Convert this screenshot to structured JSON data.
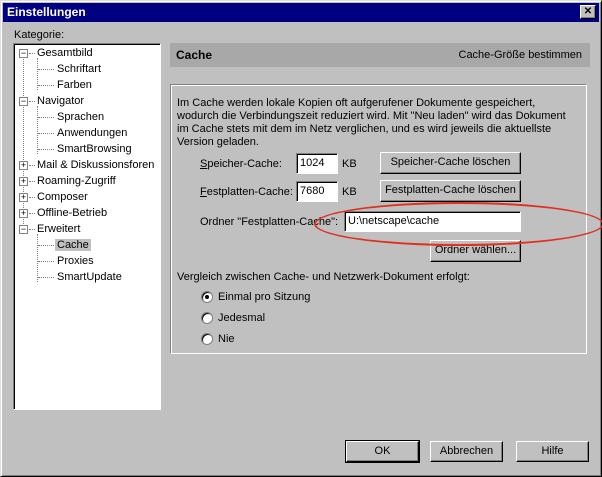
{
  "window": {
    "title": "Einstellungen",
    "close_icon": "close-icon"
  },
  "sidebar": {
    "label": "Kategorie:",
    "items": [
      {
        "label": "Gesamtbild",
        "level": 0,
        "expander": "−"
      },
      {
        "label": "Schriftart",
        "level": 1
      },
      {
        "label": "Farben",
        "level": 1
      },
      {
        "label": "Navigator",
        "level": 0,
        "expander": "−"
      },
      {
        "label": "Sprachen",
        "level": 1
      },
      {
        "label": "Anwendungen",
        "level": 1
      },
      {
        "label": "SmartBrowsing",
        "level": 1
      },
      {
        "label": "Mail & Diskussionsforen",
        "level": 0,
        "expander": "+"
      },
      {
        "label": "Roaming-Zugriff",
        "level": 0,
        "expander": "+"
      },
      {
        "label": "Composer",
        "level": 0,
        "expander": "+"
      },
      {
        "label": "Offline-Betrieb",
        "level": 0,
        "expander": "+"
      },
      {
        "label": "Erweitert",
        "level": 0,
        "expander": "−"
      },
      {
        "label": "Cache",
        "level": 1,
        "selected": true
      },
      {
        "label": "Proxies",
        "level": 1
      },
      {
        "label": "SmartUpdate",
        "level": 1
      }
    ]
  },
  "header": {
    "title": "Cache",
    "subtitle": "Cache-Größe bestimmen"
  },
  "content": {
    "description": "Im Cache werden lokale Kopien oft aufgerufener Dokumente gespeichert, wodurch die Verbindungszeit reduziert wird. Mit \"Neu laden\" wird das Dokument im Cache stets mit dem im Netz verglichen, und es wird jeweils die aktuellste Version geladen.",
    "memory_cache_label": "Speicher-Cache:",
    "memory_cache_value": "1024",
    "memory_cache_unit": "KB",
    "clear_memory_button": "Speicher-Cache löschen",
    "disk_cache_label": "Festplatten-Cache:",
    "disk_cache_value": "7680",
    "disk_cache_unit": "KB",
    "clear_disk_button": "Festplatten-Cache löschen",
    "folder_label": "Ordner \"Festplatten-Cache\":",
    "folder_value": "U:\\netscape\\cache",
    "choose_folder_button": "Ordner wählen...",
    "compare_label": "Vergleich zwischen Cache- und Netzwerk-Dokument erfolgt:",
    "radio_once": "Einmal pro Sitzung",
    "radio_every": "Jedesmal",
    "radio_never": "Nie",
    "selected_radio": "Einmal pro Sitzung"
  },
  "footer": {
    "ok": "OK",
    "cancel": "Abbrechen",
    "help": "Hilfe"
  },
  "annotation_color": "#e03020"
}
